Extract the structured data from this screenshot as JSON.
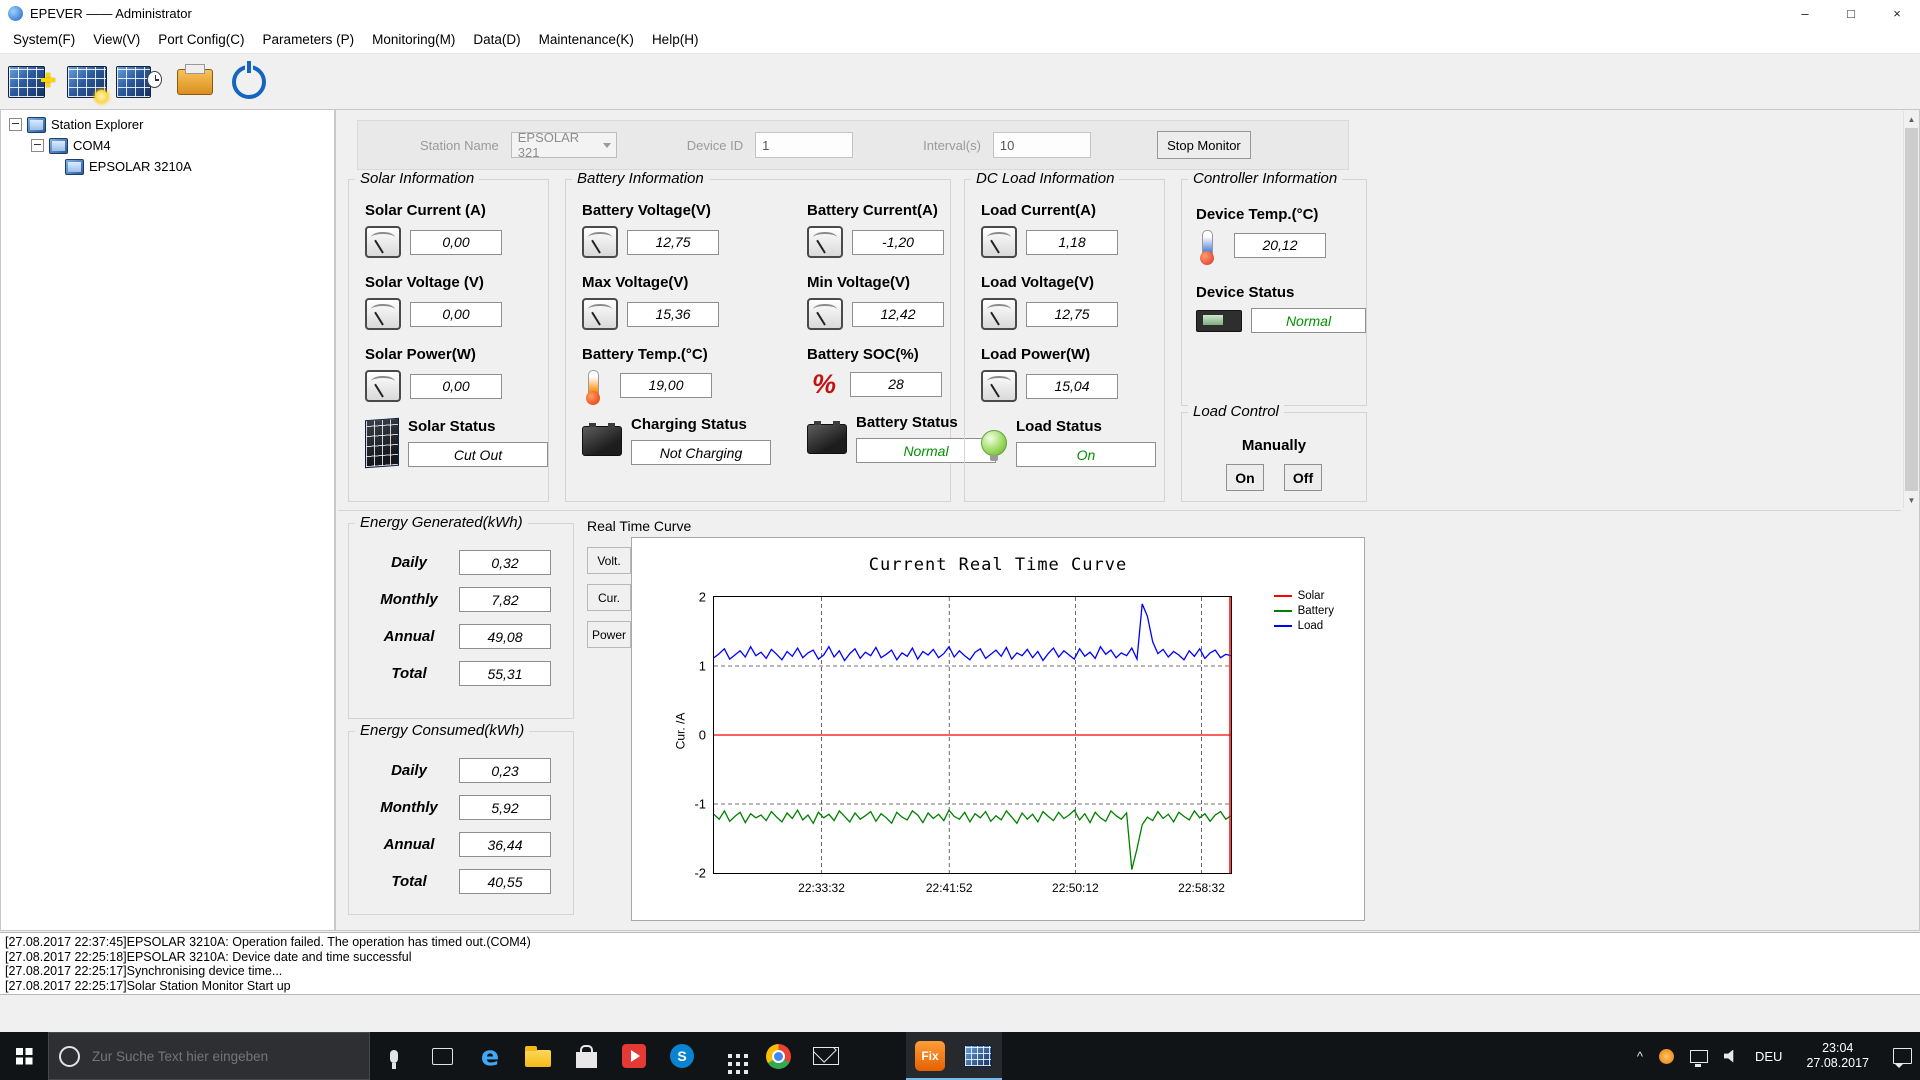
{
  "window": {
    "title": "EPEVER —— Administrator"
  },
  "icons": {
    "minimize": "–",
    "maximize": "□",
    "close": "×",
    "scroll_up": "▲",
    "scroll_down": "▼",
    "tray_chevron": "^",
    "edge_glyph": "e",
    "skype_glyph": "S",
    "percent_glyph": "%"
  },
  "menu": {
    "items": [
      {
        "label": "System(F)"
      },
      {
        "label": "View(V)"
      },
      {
        "label": "Port Config(C)"
      },
      {
        "label": "Parameters (P)"
      },
      {
        "label": "Monitoring(M)"
      },
      {
        "label": "Data(D)"
      },
      {
        "label": "Maintenance(K)"
      },
      {
        "label": "Help(H)"
      }
    ]
  },
  "tree": {
    "root": "Station Explorer",
    "port": "COM4",
    "device": "EPSOLAR 3210A"
  },
  "monitor_bar": {
    "station_name_label": "Station Name",
    "station_name_value": "EPSOLAR 321",
    "device_id_label": "Device ID",
    "device_id_value": "1",
    "interval_label": "Interval(s)",
    "interval_value": "10",
    "stop_monitor_label": "Stop Monitor"
  },
  "solar": {
    "title": "Solar Information",
    "current_label": "Solar Current (A)",
    "current_value": "0,00",
    "voltage_label": "Solar Voltage (V)",
    "voltage_value": "0,00",
    "power_label": "Solar Power(W)",
    "power_value": "0,00",
    "status_label": "Solar Status",
    "status_value": "Cut Out"
  },
  "battery": {
    "title": "Battery Information",
    "voltage_label": "Battery Voltage(V)",
    "voltage_value": "12,75",
    "current_label": "Battery Current(A)",
    "current_value": "-1,20",
    "max_voltage_label": "Max Voltage(V)",
    "max_voltage_value": "15,36",
    "min_voltage_label": "Min Voltage(V)",
    "min_voltage_value": "12,42",
    "temp_label": "Battery Temp.(°C)",
    "temp_value": "19,00",
    "soc_label": "Battery SOC(%)",
    "soc_value": "28",
    "charging_status_label": "Charging Status",
    "charging_status_value": "Not Charging",
    "battery_status_label": "Battery Status",
    "battery_status_value": "Normal"
  },
  "dc_load": {
    "title": "DC Load Information",
    "current_label": "Load Current(A)",
    "current_value": "1,18",
    "voltage_label": "Load Voltage(V)",
    "voltage_value": "12,75",
    "power_label": "Load Power(W)",
    "power_value": "15,04",
    "status_label": "Load Status",
    "status_value": "On"
  },
  "controller": {
    "title": "Controller Information",
    "temp_label": "Device Temp.(°C)",
    "temp_value": "20,12",
    "status_label": "Device Status",
    "status_value": "Normal"
  },
  "load_control": {
    "title": "Load Control",
    "mode_label": "Manually",
    "on_label": "On",
    "off_label": "Off"
  },
  "energy_generated": {
    "title": "Energy Generated(kWh)",
    "rows": [
      {
        "label": "Daily",
        "value": "0,32"
      },
      {
        "label": "Monthly",
        "value": "7,82"
      },
      {
        "label": "Annual",
        "value": "49,08"
      },
      {
        "label": "Total",
        "value": "55,31"
      }
    ]
  },
  "energy_consumed": {
    "title": "Energy Consumed(kWh)",
    "rows": [
      {
        "label": "Daily",
        "value": "0,23"
      },
      {
        "label": "Monthly",
        "value": "5,92"
      },
      {
        "label": "Annual",
        "value": "36,44"
      },
      {
        "label": "Total",
        "value": "40,55"
      }
    ]
  },
  "curve_panel": {
    "title": "Real Time Curve",
    "tabs": [
      {
        "label": "Volt."
      },
      {
        "label": "Cur."
      },
      {
        "label": "Power"
      }
    ]
  },
  "chart_data": {
    "type": "line",
    "title": "Current Real Time Curve",
    "ylabel": "Cur. /A",
    "ylim": [
      -2,
      2
    ],
    "yticks": [
      2,
      1,
      0,
      -1,
      -2
    ],
    "grid": "dashed",
    "legend_position": "right",
    "cursor_color": "#ff0000",
    "xticks": [
      {
        "label": "22:33:32",
        "pos": 0.208
      },
      {
        "label": "22:41:52",
        "pos": 0.455
      },
      {
        "label": "22:50:12",
        "pos": 0.699
      },
      {
        "label": "22:58:32",
        "pos": 0.943
      }
    ],
    "series": [
      {
        "name": "Solar",
        "color": "#ff0000",
        "values": [
          0,
          0
        ]
      },
      {
        "name": "Battery",
        "color": "#008000",
        "values": [
          -1.15,
          -1.22,
          -1.1,
          -1.25,
          -1.18,
          -1.12,
          -1.27,
          -1.14,
          -1.2,
          -1.16,
          -1.24,
          -1.11,
          -1.19,
          -1.26,
          -1.13,
          -1.21,
          -1.09,
          -1.23,
          -1.16,
          -1.28,
          -1.12,
          -1.2,
          -1.15,
          -1.24,
          -1.1,
          -1.18,
          -1.26,
          -1.13,
          -1.22,
          -1.17,
          -1.11,
          -1.25,
          -1.14,
          -1.2,
          -1.28,
          -1.12,
          -1.19,
          -1.23,
          -1.1,
          -1.16,
          -1.27,
          -1.13,
          -1.21,
          -1.15,
          -1.24,
          -1.09,
          -1.18,
          -1.22,
          -1.12,
          -1.26,
          -1.14,
          -1.2,
          -1.11,
          -1.25,
          -1.17,
          -1.23,
          -1.1,
          -1.19,
          -1.28,
          -1.13,
          -1.22,
          -1.15,
          -1.26,
          -1.11,
          -1.18,
          -1.24,
          -1.12,
          -1.21,
          -1.16,
          -1.09,
          -1.23,
          -1.14,
          -1.27,
          -1.12,
          -1.2,
          -1.25,
          -1.1,
          -1.17,
          -1.22,
          -1.13,
          -1.95,
          -1.65,
          -1.3,
          -1.19,
          -1.24,
          -1.11,
          -1.21,
          -1.15,
          -1.26,
          -1.12,
          -1.18,
          -1.23,
          -1.1,
          -1.2,
          -1.14,
          -1.25,
          -1.16,
          -1.11,
          -1.22,
          -1.17
        ]
      },
      {
        "name": "Load",
        "color": "#0000ff",
        "values": [
          1.12,
          1.18,
          1.25,
          1.1,
          1.16,
          1.22,
          1.13,
          1.28,
          1.15,
          1.2,
          1.11,
          1.24,
          1.17,
          1.09,
          1.21,
          1.14,
          1.26,
          1.12,
          1.19,
          1.23,
          1.1,
          1.16,
          1.28,
          1.13,
          1.22,
          1.08,
          1.18,
          1.25,
          1.11,
          1.2,
          1.15,
          1.27,
          1.12,
          1.17,
          1.23,
          1.09,
          1.19,
          1.14,
          1.26,
          1.1,
          1.21,
          1.16,
          1.24,
          1.12,
          1.18,
          1.28,
          1.13,
          1.22,
          1.15,
          1.09,
          1.2,
          1.25,
          1.11,
          1.17,
          1.23,
          1.14,
          1.27,
          1.1,
          1.19,
          1.15,
          1.24,
          1.12,
          1.21,
          1.08,
          1.18,
          1.26,
          1.13,
          1.22,
          1.16,
          1.1,
          1.25,
          1.14,
          1.2,
          1.11,
          1.28,
          1.17,
          1.23,
          1.12,
          1.19,
          1.15,
          1.26,
          1.1,
          1.9,
          1.72,
          1.35,
          1.18,
          1.24,
          1.13,
          1.21,
          1.16,
          1.09,
          1.22,
          1.14,
          1.25,
          1.11,
          1.19,
          1.23,
          1.12,
          1.17,
          1.15
        ]
      }
    ]
  },
  "log": {
    "lines": [
      "[27.08.2017 22:37:45]EPSOLAR 3210A: Operation failed. The operation has timed out.(COM4)",
      "[27.08.2017 22:25:18]EPSOLAR 3210A: Device date and time successful",
      "[27.08.2017 22:25:17]Synchronising device time...",
      "[27.08.2017 22:25:17]Solar Station Monitor Start up"
    ]
  },
  "taskbar": {
    "search_placeholder": "Zur Suche Text hier eingeben",
    "fix_app_label": "Fix",
    "language": "DEU",
    "time": "23:04",
    "date": "27.08.2017"
  },
  "colors": {
    "status_green": "#009100",
    "solar_red": "#ff0000",
    "battery_green": "#008000",
    "load_blue": "#0000ff"
  }
}
